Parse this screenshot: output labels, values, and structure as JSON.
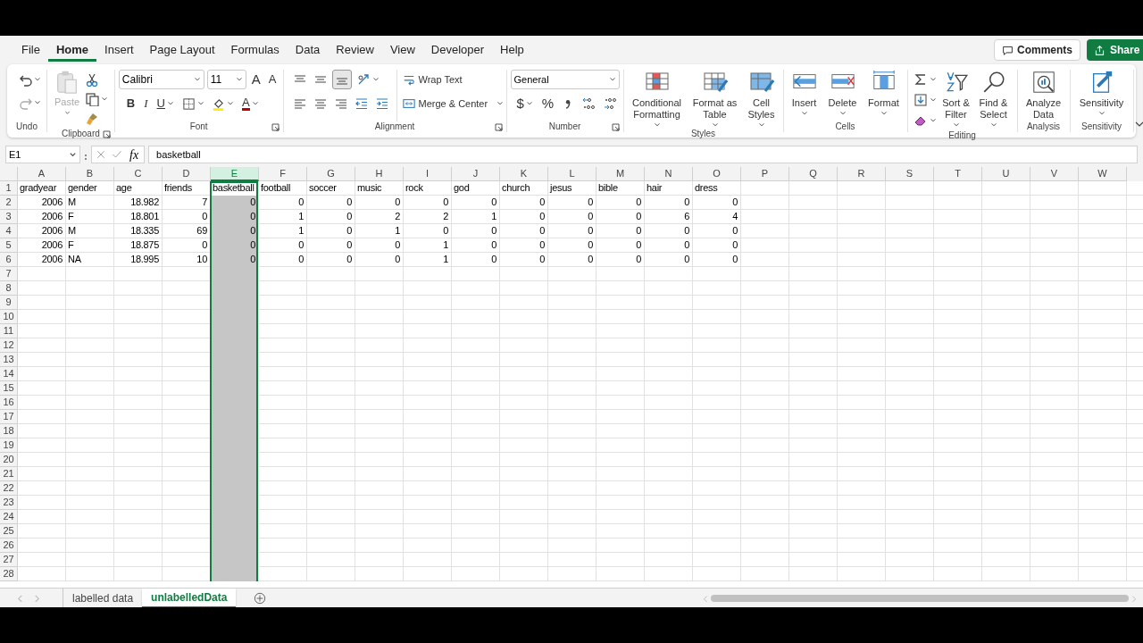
{
  "menu_tabs": [
    {
      "label": "File",
      "selected": false
    },
    {
      "label": "Home",
      "selected": true
    },
    {
      "label": "Insert",
      "selected": false
    },
    {
      "label": "Page Layout",
      "selected": false
    },
    {
      "label": "Formulas",
      "selected": false
    },
    {
      "label": "Data",
      "selected": false
    },
    {
      "label": "Review",
      "selected": false
    },
    {
      "label": "View",
      "selected": false
    },
    {
      "label": "Developer",
      "selected": false
    },
    {
      "label": "Help",
      "selected": false
    }
  ],
  "header_buttons": {
    "comments": "Comments",
    "share": "Share"
  },
  "ribbon": [
    {
      "kind": "undo",
      "label": "Undo"
    },
    {
      "kind": "clipboard",
      "label": "Clipboard",
      "paste": "Paste"
    },
    {
      "kind": "font",
      "label": "Font",
      "font_name": "Calibri",
      "font_size": "11",
      "grow": "A",
      "shrink": "A",
      "bold": "B",
      "italic": "I",
      "underline": "U",
      "font_color": "A"
    },
    {
      "kind": "alignment",
      "label": "Alignment",
      "wrap": "Wrap Text",
      "merge": "Merge & Center"
    },
    {
      "kind": "number",
      "label": "Number",
      "format": "General",
      "currency": "$",
      "percent": "%"
    },
    {
      "kind": "buttons",
      "label": "Styles",
      "buttons": [
        {
          "label": "Conditional Formatting",
          "dropdown": true
        },
        {
          "label": "Format as Table",
          "dropdown": true
        },
        {
          "label": "Cell Styles",
          "dropdown": true
        }
      ]
    },
    {
      "kind": "buttons",
      "label": "Cells",
      "buttons": [
        {
          "label": "Insert",
          "dropdown": true
        },
        {
          "label": "Delete",
          "dropdown": true
        },
        {
          "label": "Format",
          "dropdown": true
        }
      ]
    },
    {
      "kind": "editing",
      "label": "Editing",
      "buttons": [
        {
          "label": "Sort & Filter",
          "dropdown": true
        },
        {
          "label": "Find & Select",
          "dropdown": true
        }
      ]
    },
    {
      "kind": "buttons",
      "label": "Analysis",
      "buttons": [
        {
          "label": "Analyze Data",
          "dropdown": false
        }
      ]
    },
    {
      "kind": "buttons",
      "label": "Sensitivity",
      "buttons": [
        {
          "label": "Sensitivity",
          "dropdown": true
        }
      ]
    }
  ],
  "formula_bar": {
    "name_box": "E1",
    "fx": "fx",
    "formula": "basketball"
  },
  "columns": [
    {
      "letter": "A",
      "selected": false,
      "kind": "number"
    },
    {
      "letter": "B",
      "selected": false,
      "kind": "text"
    },
    {
      "letter": "C",
      "selected": false,
      "kind": "number"
    },
    {
      "letter": "D",
      "selected": false,
      "kind": "number"
    },
    {
      "letter": "E",
      "selected": true,
      "kind": "number"
    },
    {
      "letter": "F",
      "selected": false,
      "kind": "number"
    },
    {
      "letter": "G",
      "selected": false,
      "kind": "number"
    },
    {
      "letter": "H",
      "selected": false,
      "kind": "number"
    },
    {
      "letter": "I",
      "selected": false,
      "kind": "number"
    },
    {
      "letter": "J",
      "selected": false,
      "kind": "number"
    },
    {
      "letter": "K",
      "selected": false,
      "kind": "number"
    },
    {
      "letter": "L",
      "selected": false,
      "kind": "number"
    },
    {
      "letter": "M",
      "selected": false,
      "kind": "number"
    },
    {
      "letter": "N",
      "selected": false,
      "kind": "number"
    },
    {
      "letter": "O",
      "selected": false,
      "kind": "number"
    },
    {
      "letter": "P",
      "selected": false
    },
    {
      "letter": "Q",
      "selected": false
    },
    {
      "letter": "R",
      "selected": false
    },
    {
      "letter": "S",
      "selected": false
    },
    {
      "letter": "T",
      "selected": false
    },
    {
      "letter": "U",
      "selected": false
    },
    {
      "letter": "V",
      "selected": false
    },
    {
      "letter": "W",
      "selected": false
    }
  ],
  "row_numbers": [
    "1",
    "2",
    "3",
    "4",
    "5",
    "6",
    "7",
    "8",
    "9",
    "10",
    "11",
    "12",
    "13",
    "14",
    "15",
    "16",
    "17",
    "18",
    "19",
    "20",
    "21",
    "22",
    "23",
    "24",
    "25",
    "26",
    "27",
    "28"
  ],
  "header_row": [
    "gradyear",
    "gender",
    "age",
    "friends",
    "basketball",
    "football",
    "soccer",
    "music",
    "rock",
    "god",
    "church",
    "jesus",
    "bible",
    "hair",
    "dress"
  ],
  "rows": [
    [
      "2006",
      "M",
      "18.982",
      "7",
      "0",
      "0",
      "0",
      "0",
      "0",
      "0",
      "0",
      "0",
      "0",
      "0",
      "0"
    ],
    [
      "2006",
      "F",
      "18.801",
      "0",
      "0",
      "1",
      "0",
      "2",
      "2",
      "1",
      "0",
      "0",
      "0",
      "6",
      "4"
    ],
    [
      "2006",
      "M",
      "18.335",
      "69",
      "0",
      "1",
      "0",
      "1",
      "0",
      "0",
      "0",
      "0",
      "0",
      "0",
      "0"
    ],
    [
      "2006",
      "F",
      "18.875",
      "0",
      "0",
      "0",
      "0",
      "0",
      "1",
      "0",
      "0",
      "0",
      "0",
      "0",
      "0"
    ],
    [
      "2006",
      "NA",
      "18.995",
      "10",
      "0",
      "0",
      "0",
      "0",
      "1",
      "0",
      "0",
      "0",
      "0",
      "0",
      "0"
    ]
  ],
  "sheet_tabs": [
    {
      "label": "labelled data",
      "selected": false
    },
    {
      "label": "unlabelledData",
      "selected": true
    }
  ]
}
